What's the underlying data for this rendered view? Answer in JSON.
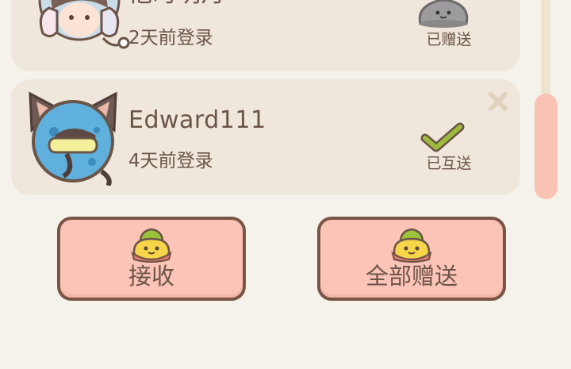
{
  "friends": [
    {
      "name": "他时明月",
      "last_login": "2天前登录",
      "status": "已赠送",
      "status_icon": "stone-pet-icon",
      "avatar": "girl-with-headphones-avatar"
    },
    {
      "name": "Edward111",
      "last_login": "4天前登录",
      "status": "已互送",
      "status_icon": "checkmark-icon",
      "avatar": "cat-with-goggles-avatar"
    }
  ],
  "actions": {
    "receive_label": "接收",
    "send_all_label": "全部赠送",
    "button_icon": "slime-gift-icon"
  },
  "colors": {
    "page_bg": "#f5f2ec",
    "card_bg": "#efe7db",
    "button_bg": "#fbc4b6",
    "button_border": "#7a5546",
    "text": "#6b5448",
    "checkmark": "#9dbb3a",
    "scroll_thumb": "#f9c2b3"
  }
}
